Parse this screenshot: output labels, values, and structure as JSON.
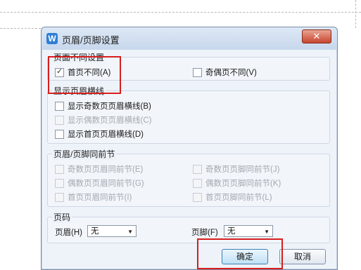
{
  "dialog": {
    "title": "页眉/页脚设置",
    "app_icon": "W",
    "close_icon": "✕"
  },
  "groups": {
    "diff": {
      "label": "页面不同设置",
      "first_page": {
        "label": "首页不同(A)",
        "checked": true
      },
      "odd_even": {
        "label": "奇偶页不同(V)",
        "checked": false
      }
    },
    "line": {
      "label": "显示页眉横线",
      "odd": {
        "label": "显示奇数页页眉横线(B)"
      },
      "even": {
        "label": "显示偶数页页眉横线(C)"
      },
      "first": {
        "label": "显示首页页眉横线(D)"
      }
    },
    "same": {
      "label": "页眉/页脚同前节",
      "odd_header": {
        "label": "奇数页页眉同前节(E)"
      },
      "odd_footer": {
        "label": "奇数页页脚同前节(J)"
      },
      "even_header": {
        "label": "偶数页页眉同前节(G)"
      },
      "even_footer": {
        "label": "偶数页页脚同前节(K)"
      },
      "first_header": {
        "label": "首页页眉同前节(I)"
      },
      "first_footer": {
        "label": "首页页脚同前节(L)"
      }
    },
    "pagenum": {
      "label": "页码",
      "header_label": "页眉(H)",
      "header_value": "无",
      "footer_label": "页脚(F)",
      "footer_value": "无"
    }
  },
  "buttons": {
    "ok": "确定",
    "cancel": "取消"
  },
  "colors": {
    "highlight": "#d61e1e",
    "title_bar": "#c7d7ec"
  }
}
